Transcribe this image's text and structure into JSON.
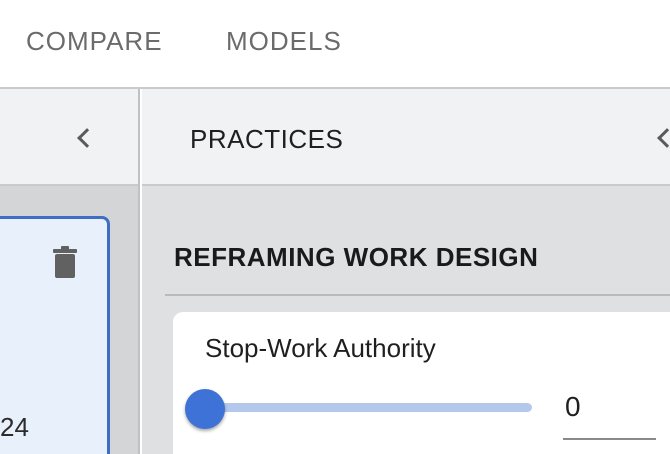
{
  "nav": {
    "tabs": [
      {
        "label": "COMPARE"
      },
      {
        "label": "MODELS"
      }
    ]
  },
  "left_panel": {
    "card_number_fragment": "24",
    "collapse_icon": "chevron-left-icon",
    "delete_icon": "trash-icon"
  },
  "right_panel": {
    "title": "PRACTICES",
    "collapse_icon": "chevron-left-icon",
    "section_title": "REFRAMING WORK DESIGN",
    "item": {
      "label": "Stop-Work Authority",
      "value": "0",
      "slider_fraction": 0
    }
  },
  "colors": {
    "accent": "#3e72d6",
    "selected_card_border": "#3f6fc4",
    "selected_card_bg": "#e8f0fb",
    "slider_track": "#b3c8ea"
  }
}
